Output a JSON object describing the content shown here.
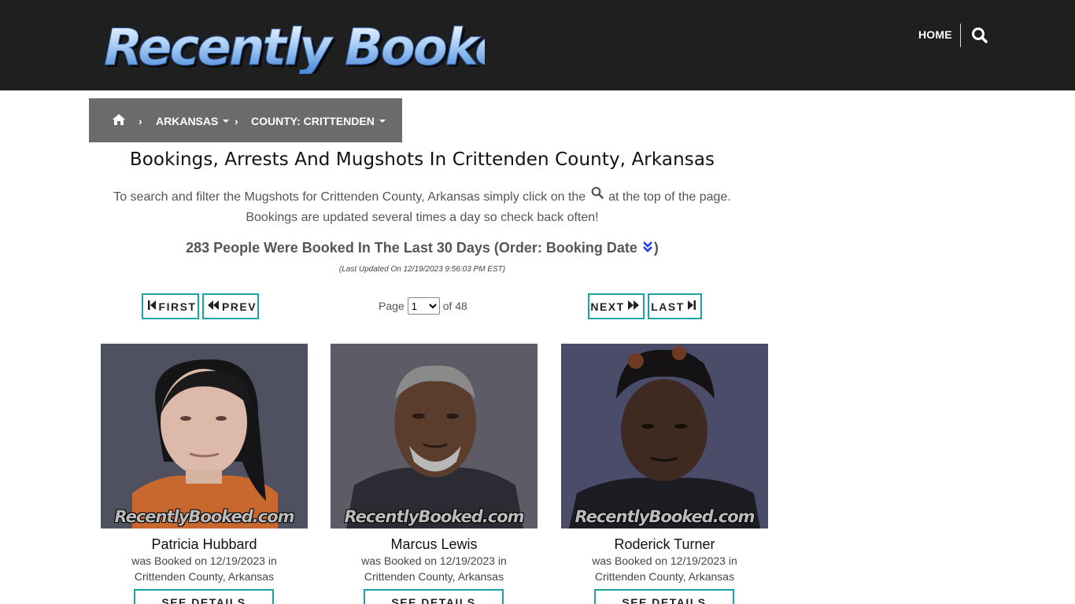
{
  "site": {
    "logo_text": "Recently Booked",
    "nav": {
      "home": "HOME",
      "search_icon": "search-icon"
    }
  },
  "breadcrumb": {
    "home_icon": "home-icon",
    "state": "ARKANSAS",
    "county": "COUNTY: CRITTENDEN",
    "separator": "›"
  },
  "page": {
    "title": "Bookings, Arrests And Mugshots In Crittenden County, Arkansas",
    "intro_part1": "To search and filter the Mugshots for Crittenden County, Arkansas simply click on the",
    "intro_part2": "at the top of the page.",
    "intro_line2": "Bookings are updated several times a day so check back often!",
    "count_text": "283 People Were Booked In The Last 30 Days (Order: Booking Date",
    "count_close": ")",
    "updated": "(Last Updated On 12/19/2023 9:56:03 PM EST)"
  },
  "pagination": {
    "first": "FIRST",
    "prev": "PREV",
    "next": "NEXT",
    "last": "LAST",
    "page_label": "Page",
    "current_page": "1",
    "of_label": "of 48"
  },
  "colors": {
    "header_bg": "#1f1f1f",
    "breadcrumb_bg": "#6b6b6b",
    "accent": "#1aa5a5",
    "order_icon": "#1a3fd6"
  },
  "watermark": "RecentlyBooked.com",
  "bookings": [
    {
      "name": "Patricia Hubbard",
      "line1": "was Booked on 12/19/2023 in",
      "line2": "Crittenden County, Arkansas",
      "button": "SEE DETAILS"
    },
    {
      "name": "Marcus Lewis",
      "line1": "was Booked on 12/19/2023 in",
      "line2": "Crittenden County, Arkansas",
      "button": "SEE DETAILS"
    },
    {
      "name": "Roderick Turner",
      "line1": "was Booked on 12/19/2023 in",
      "line2": "Crittenden County, Arkansas",
      "button": "SEE DETAILS"
    }
  ]
}
